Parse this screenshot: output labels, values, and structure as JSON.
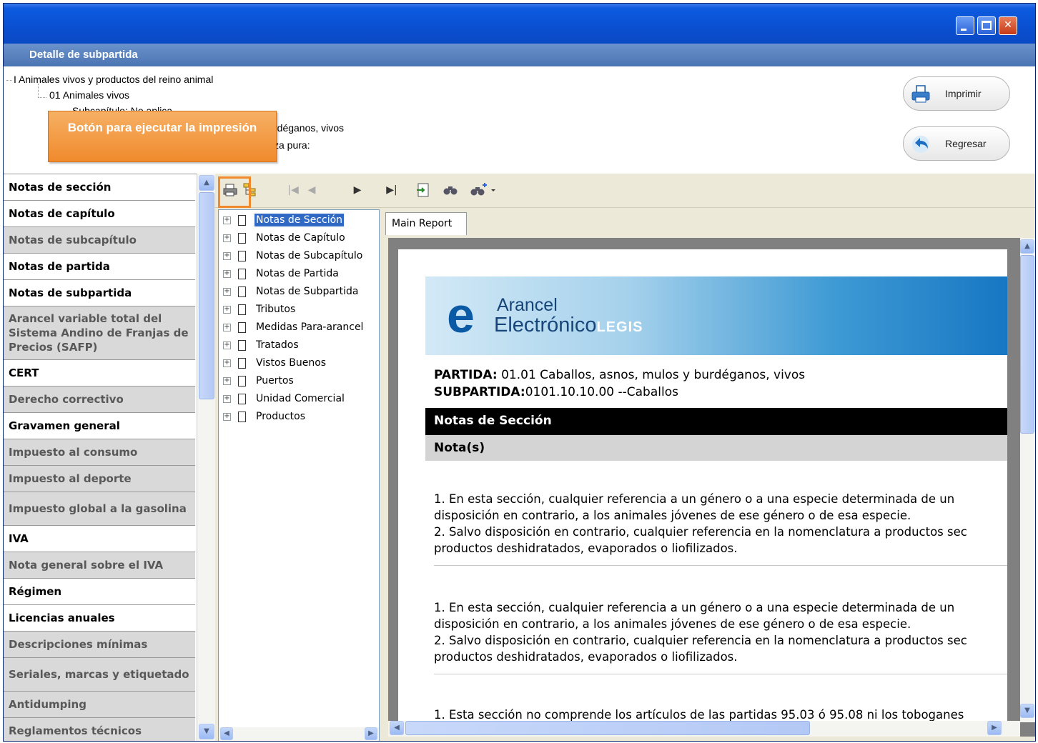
{
  "window": {
    "title": "",
    "controls": {
      "minimize_icon": "minimize-icon",
      "maximize_icon": "maximize-icon",
      "close_icon": "close-icon"
    }
  },
  "subheader": {
    "title": "Detalle de subpartida"
  },
  "header_tree": {
    "line1": "I Animales vivos y productos del reino animal",
    "line2": "01 Animales vivos",
    "line3": "Subcapítulo: No aplica",
    "line4_fragment": "rdéganos, vivos",
    "line5_fragment": "za pura:"
  },
  "callout": {
    "text": "Botón para ejecutar la impresión"
  },
  "actions": {
    "print_label": "Imprimir",
    "back_label": "Regresar"
  },
  "left_nav": {
    "items": [
      {
        "label": "Notas de sección",
        "state": "active"
      },
      {
        "label": "Notas de capítulo",
        "state": "active"
      },
      {
        "label": "Notas de subcapítulo",
        "state": "inactive"
      },
      {
        "label": "Notas de partida",
        "state": "active"
      },
      {
        "label": "Notas de subpartida",
        "state": "active"
      },
      {
        "label": "Arancel variable total del Sistema Andino de Franjas de Precios (SAFP)",
        "state": "inactive"
      },
      {
        "label": "CERT",
        "state": "active"
      },
      {
        "label": "Derecho correctivo",
        "state": "inactive"
      },
      {
        "label": "Gravamen general",
        "state": "active"
      },
      {
        "label": "Impuesto al consumo",
        "state": "inactive"
      },
      {
        "label": "Impuesto al deporte",
        "state": "inactive"
      },
      {
        "label": "Impuesto global a la gasolina",
        "state": "inactive"
      },
      {
        "label": "IVA",
        "state": "active"
      },
      {
        "label": "Nota general sobre el IVA",
        "state": "inactive"
      },
      {
        "label": "Régimen",
        "state": "active"
      },
      {
        "label": "Licencias anuales",
        "state": "active"
      },
      {
        "label": "Descripciones mínimas",
        "state": "inactive"
      },
      {
        "label": "Seriales, marcas y etiquetado",
        "state": "inactive"
      },
      {
        "label": "Antidumping",
        "state": "inactive"
      },
      {
        "label": "Reglamentos técnicos",
        "state": "inactive"
      }
    ]
  },
  "toolbar": {
    "icons": [
      "print-icon",
      "group-tree-toggle-icon",
      "first-page-icon",
      "previous-page-icon",
      "next-page-icon",
      "last-page-icon",
      "export-icon",
      "search-icon",
      "zoom-icon"
    ]
  },
  "group_tree": {
    "items": [
      {
        "label": "Notas de Sección",
        "selected": true
      },
      {
        "label": "Notas de Capítulo",
        "selected": false
      },
      {
        "label": "Notas de Subcapítulo",
        "selected": false
      },
      {
        "label": "Notas de Partida",
        "selected": false
      },
      {
        "label": "Notas de Subpartida",
        "selected": false
      },
      {
        "label": "Tributos",
        "selected": false
      },
      {
        "label": "Medidas Para-arancel",
        "selected": false
      },
      {
        "label": "Tratados",
        "selected": false
      },
      {
        "label": "Vistos Buenos",
        "selected": false
      },
      {
        "label": "Puertos",
        "selected": false
      },
      {
        "label": "Unidad Comercial",
        "selected": false
      },
      {
        "label": "Productos",
        "selected": false
      }
    ]
  },
  "report": {
    "tab_label": "Main Report",
    "logo": {
      "line1": "Arancel",
      "line2": "Electrónico",
      "legis": "LEGIS"
    },
    "partida_label": "PARTIDA:",
    "partida_value": " 01.01 Caballos, asnos, mulos y burdéganos, vivos",
    "subpartida_label": "SUBPARTIDA:",
    "subpartida_value": "0101.10.10.00 --Caballos",
    "section_title": "Notas de Sección",
    "notes_title": "Nota(s)",
    "block1": {
      "l1": "1. En esta sección, cualquier referencia a un género o a una especie determinada de un",
      "l2": "disposición en contrario, a los animales jóvenes de ese género o de esa especie.",
      "l3": "2. Salvo disposición en contrario, cualquier referencia en la nomenclatura a productos sec",
      "l4": "productos deshidratados, evaporados o liofilizados."
    },
    "block2": {
      "l1": "1. En esta sección, cualquier referencia a un género o a una especie determinada de un",
      "l2": "disposición en contrario, a los animales jóvenes de ese género o de esa especie.",
      "l3": "2. Salvo disposición en contrario, cualquier referencia en la nomenclatura a productos sec",
      "l4": "productos deshidratados, evaporados o liofilizados."
    },
    "block3_partial": "1. Esta sección no comprende los artículos de las partidas 95.03 ó 95.08 ni los toboganes"
  },
  "colors": {
    "titlebar": "#0a4fd1",
    "subheader": "#4a74b2",
    "callout": "#f08a2c",
    "selection": "#316ac5",
    "inactive_nav": "#d9d9d9"
  }
}
